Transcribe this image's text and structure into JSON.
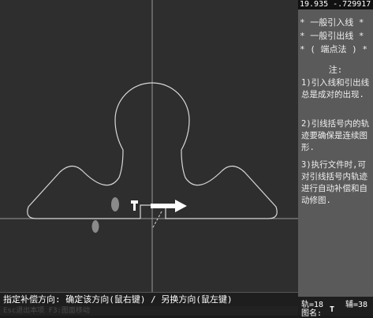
{
  "header": {
    "coordinates": "19.935 -.729917"
  },
  "menu": {
    "items": [
      "* 一般引入线 *",
      "* 一般引出线 *",
      "* ( 端点法 ) *"
    ]
  },
  "notes": {
    "title": "注:",
    "items": [
      "1)引入线和引出线总是成对的出现.",
      "2)引线括号内的轨迹要确保是连续图形.",
      "3)执行文件时,可对引线括号内轨迹进行自动补偿和自动修图."
    ]
  },
  "status": {
    "prompt": "指定补偿方向: 确定该方向(鼠右键) / 另换方向(鼠左键)",
    "hint": "Esc退出本项      F3:图面移动"
  },
  "counts": {
    "track": "轨=18",
    "aux": "辅=38",
    "figure": "图名:"
  },
  "canvas": {
    "drawing_color": "#d8d8d8",
    "axis_color": "#9a9a9a",
    "background_color": "#2e2e2e",
    "markers": [
      "start-marker-icon",
      "direction-arrow-icon"
    ]
  }
}
